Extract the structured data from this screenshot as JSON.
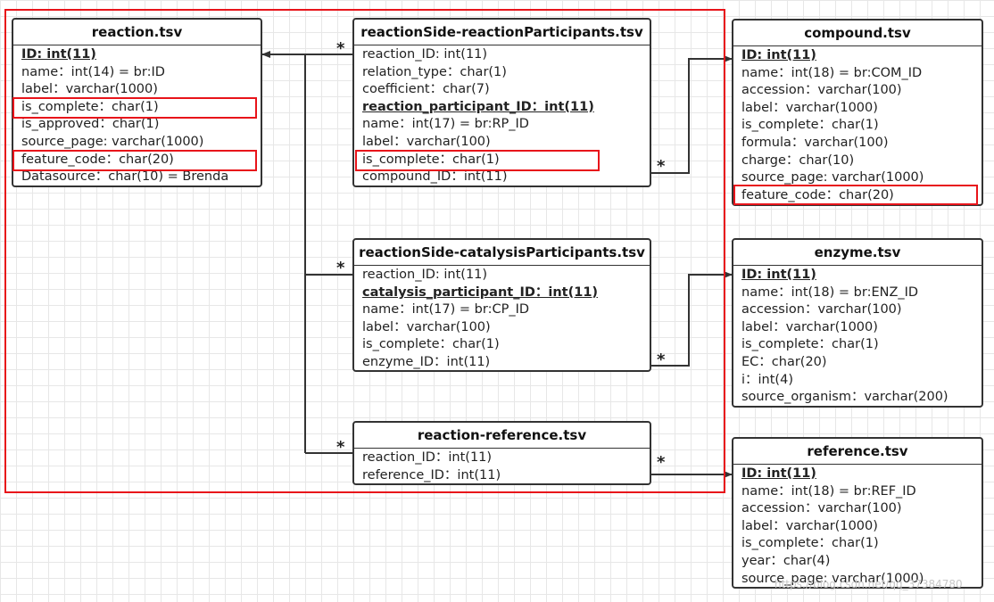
{
  "tables": {
    "reaction": {
      "title": "reaction.tsv",
      "fields": [
        "ID: int(11)",
        "name：int(14) = br:ID",
        "label：varchar(1000)",
        "is_complete：char(1)",
        "is_approved：char(1)",
        "source_page: varchar(1000)",
        "feature_code：char(20)",
        "Datasource：char(10) = Brenda"
      ]
    },
    "rp": {
      "title": "reactionSide-reactionParticipants.tsv",
      "fields": [
        "reaction_ID: int(11)",
        "relation_type：char(1)",
        "coefficient：char(7)",
        "reaction_participant_ID：int(11)",
        "name：int(17) = br:RP_ID",
        "label：varchar(100)",
        "is_complete：char(1)",
        "compound_ID：int(11)"
      ]
    },
    "compound": {
      "title": "compound.tsv",
      "fields": [
        "ID: int(11)",
        "name：int(18) = br:COM_ID",
        "accession：varchar(100)",
        "label：varchar(1000)",
        "is_complete：char(1)",
        "formula：varchar(100)",
        "charge：char(10)",
        "source_page: varchar(1000)",
        "feature_code：char(20)"
      ]
    },
    "cp": {
      "title": "reactionSide-catalysisParticipants.tsv",
      "fields": [
        "reaction_ID: int(11)",
        "catalysis_participant_ID：int(11)",
        "name：int(17) = br:CP_ID",
        "label：varchar(100)",
        "is_complete：char(1)",
        "enzyme_ID：int(11)"
      ]
    },
    "enzyme": {
      "title": "enzyme.tsv",
      "fields": [
        "ID: int(11)",
        "name：int(18) = br:ENZ_ID",
        "accession：varchar(100)",
        "label：varchar(1000)",
        "is_complete：char(1)",
        "EC：char(20)",
        "i：int(4)",
        "source_organism：varchar(200)"
      ]
    },
    "rr": {
      "title": "reaction-reference.tsv",
      "fields": [
        "reaction_ID：int(11)",
        "reference_ID：int(11)"
      ]
    },
    "reference": {
      "title": "reference.tsv",
      "fields": [
        "ID: int(11)",
        "name：int(18) = br:REF_ID",
        "accession：varchar(100)",
        "label：varchar(1000)",
        "is_complete：char(1)",
        "year：char(4)",
        "source_page: varchar(1000)"
      ]
    }
  },
  "multiplicity": "*",
  "watermark": "https://blog.csdn.net/qq_37384780",
  "colors": {
    "highlight": "#e8141a",
    "line": "#333333"
  }
}
